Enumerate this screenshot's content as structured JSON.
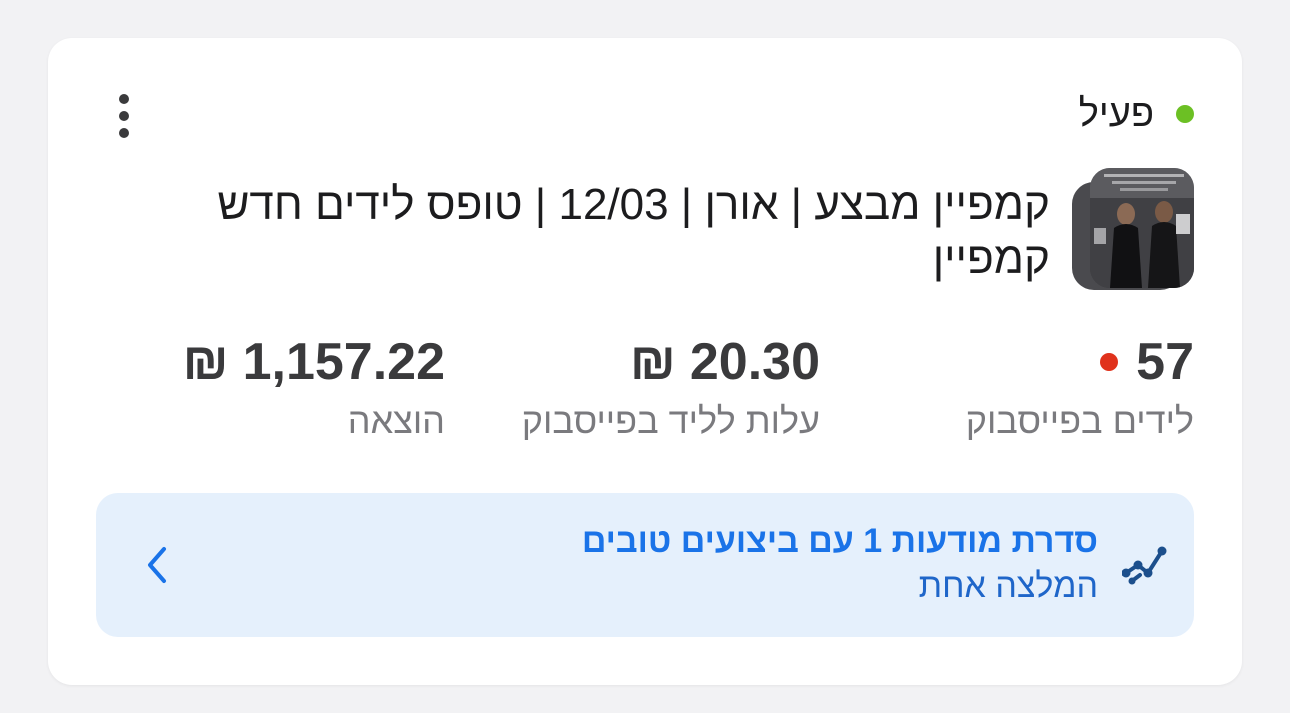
{
  "status": {
    "label": "פעיל",
    "color": "#6cc024"
  },
  "menu": {
    "icon": "more-vertical-icon"
  },
  "campaign": {
    "title_line1": "קמפיין מבצע  | אורן | 12/03 | טופס לידים חדש",
    "title_line2": "קמפיין",
    "thumbnail": "campaign-thumbnail-image"
  },
  "metrics": [
    {
      "value": "57",
      "label": "לידים בפייסבוק",
      "indicator_color": "#e0321c"
    },
    {
      "value": "20.30",
      "currency": "₪",
      "label": "עלות לליד בפייסבוק"
    },
    {
      "value": "1,157.22",
      "currency": "₪",
      "label": "הוצאה"
    }
  ],
  "recommendation": {
    "title": "סדרת מודעות 1 עם ביצועים טובים",
    "subtitle": "המלצה אחת",
    "icon": "trend-line-icon",
    "chevron": "chevron-left-icon",
    "bg_color": "#e5f0fc",
    "accent_color": "#1a73e8",
    "subtitle_color": "#1f66c9",
    "icon_color": "#1c4f8c"
  }
}
